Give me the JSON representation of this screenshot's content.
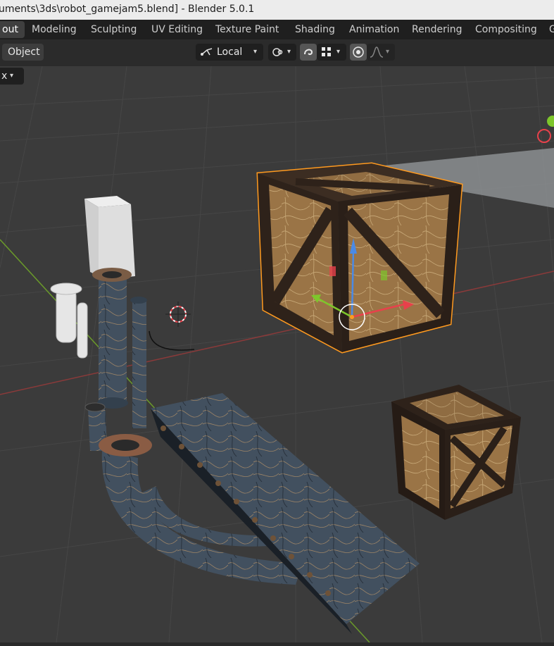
{
  "window": {
    "title": "uments\\3ds\\robot_gamejam5.blend] - Blender 5.0.1"
  },
  "workspace_tabs": [
    {
      "label": "out",
      "active": true
    },
    {
      "label": "Modeling",
      "active": false
    },
    {
      "label": "Sculpting",
      "active": false
    },
    {
      "label": "UV Editing",
      "active": false
    },
    {
      "label": "Texture Paint",
      "active": false
    },
    {
      "label": "Shading",
      "active": false
    },
    {
      "label": "Animation",
      "active": false
    },
    {
      "label": "Rendering",
      "active": false
    },
    {
      "label": "Compositing",
      "active": false
    },
    {
      "label": "G",
      "active": false
    }
  ],
  "header": {
    "mode_menu": "Object",
    "transform_orientation": "Local",
    "pivot_icon": "pivot-icon",
    "snap_icon": "snap-magnet-icon",
    "snap_target_icon": "snap-grid-icon",
    "proportional_icon": "proportional-edit-icon",
    "falloff_icon": "falloff-curve-icon"
  },
  "viewport": {
    "left_dropdown_text": "x",
    "background_color": "#3b3b3b",
    "grid_color": "#4a4a4a",
    "x_axis_color": "#8a3a3a",
    "y_axis_color": "#6a9a2a",
    "selection_outline": "#ff9a1f",
    "gizmo_x_color": "#e8414b",
    "gizmo_y_color": "#7ec62b",
    "gizmo_z_color": "#4a8ae6"
  }
}
